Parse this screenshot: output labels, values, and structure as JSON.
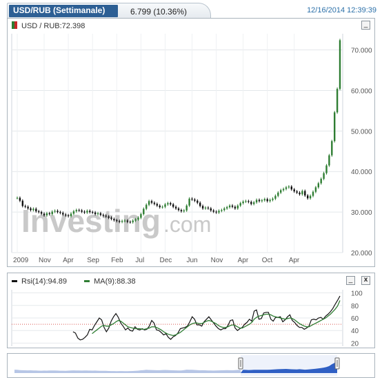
{
  "header": {
    "symbol": "USD/RUB (Settimanale)",
    "change": "6.799 (10.36%)",
    "timestamp": "12/16/2014 12:39:39"
  },
  "main_legend": {
    "label": "USD / RUB:72.398"
  },
  "rsi_legend": {
    "rsi_label": "Rsi(14):94.89",
    "ma_label": "MA(9):88.38"
  },
  "buttons": {
    "minimize": "_",
    "close": "x"
  },
  "watermark": {
    "brand": "Investing",
    "suffix": ".com"
  },
  "colors": {
    "up": "#2e7d32",
    "down": "#111111",
    "ma": "#2e7d32",
    "rsi": "#111111",
    "ref_line": "#d9534f",
    "nav_fill": "#2f5fc4"
  },
  "chart_data": [
    {
      "type": "line",
      "title": "USD / RUB",
      "ylim": [
        20,
        74
      ],
      "yticks": [
        "20.000",
        "30.000",
        "40.000",
        "50.000",
        "60.000",
        "70.000"
      ],
      "ytick_values": [
        20,
        30,
        40,
        50,
        60,
        70
      ],
      "xtick_labels": [
        "2009",
        "Nov",
        "Apr",
        "Sep",
        "Feb",
        "Jul",
        "Dec",
        "Jun",
        "Nov",
        "Apr",
        "Oct",
        "Apr"
      ],
      "xtick_index": [
        0,
        10,
        19,
        28,
        37,
        46,
        55,
        65,
        74,
        84,
        93,
        103
      ],
      "series": [
        {
          "name": "USD / RUB",
          "values": [
            33.5,
            32.8,
            31.5,
            31.3,
            30.9,
            30.5,
            30.8,
            30.2,
            30.0,
            29.6,
            29.2,
            29.7,
            29.5,
            30.1,
            30.3,
            30.0,
            29.8,
            29.4,
            29.2,
            29.0,
            29.6,
            30.2,
            30.5,
            30.4,
            30.1,
            29.9,
            30.3,
            30.0,
            29.9,
            29.5,
            29.7,
            29.3,
            29.1,
            28.9,
            28.6,
            28.3,
            28.0,
            27.8,
            27.6,
            27.8,
            27.9,
            27.6,
            27.5,
            27.9,
            28.2,
            28.6,
            29.5,
            30.8,
            31.8,
            32.7,
            32.3,
            32.0,
            31.6,
            31.2,
            31.3,
            31.9,
            32.2,
            31.9,
            31.3,
            30.9,
            30.5,
            30.2,
            30.4,
            31.6,
            33.3,
            33.1,
            32.8,
            32.3,
            31.5,
            30.9,
            31.1,
            30.9,
            30.4,
            30.1,
            29.9,
            30.3,
            30.5,
            30.9,
            31.2,
            31.6,
            31.3,
            30.9,
            31.6,
            32.2,
            32.6,
            32.7,
            32.5,
            32.0,
            32.4,
            33.0,
            32.7,
            32.9,
            33.2,
            32.7,
            33.0,
            33.3,
            34.0,
            34.8,
            35.4,
            35.7,
            36.1,
            36.3,
            35.6,
            35.1,
            34.8,
            34.4,
            35.2,
            34.1,
            33.4,
            34.0,
            35.0,
            36.1,
            37.1,
            38.2,
            39.6,
            41.5,
            44.0,
            47.5,
            54.6,
            60.4,
            72.4
          ]
        }
      ]
    },
    {
      "type": "line",
      "title": "Rsi(14)",
      "ylim": [
        15,
        105
      ],
      "yticks": [
        "20",
        "40",
        "60",
        "80",
        "100"
      ],
      "ytick_values": [
        20,
        40,
        60,
        80,
        100
      ],
      "reference_line": 50,
      "series": [
        {
          "name": "Rsi(14)",
          "values": [
            null,
            null,
            null,
            null,
            null,
            null,
            null,
            null,
            null,
            null,
            null,
            null,
            null,
            null,
            null,
            null,
            null,
            null,
            null,
            null,
            null,
            null,
            null,
            null,
            38,
            36,
            28,
            25,
            26,
            29,
            33,
            42,
            41,
            48,
            54,
            60,
            57,
            45,
            38,
            44,
            55,
            62,
            67,
            61,
            52,
            47,
            41,
            44,
            40,
            39,
            46,
            42,
            41,
            43,
            41,
            42,
            47,
            56,
            52,
            41,
            40,
            37,
            33,
            35,
            29,
            26,
            30,
            32,
            36,
            43,
            44,
            45,
            47,
            54,
            62,
            58,
            49,
            49,
            47,
            54,
            58,
            62,
            57,
            52,
            47,
            43,
            41,
            43,
            43,
            48,
            56,
            57,
            44,
            40,
            43,
            45,
            50,
            53,
            58,
            55,
            71,
            73,
            58,
            59,
            68,
            69,
            69,
            58,
            55,
            61,
            61,
            62,
            54,
            57,
            62,
            65,
            56,
            53,
            48,
            45,
            45,
            42,
            44,
            47,
            57,
            58,
            57,
            60,
            61,
            58,
            63,
            66,
            70,
            75,
            82,
            88,
            95
          ]
        },
        {
          "name": "MA(9)",
          "values": [
            null,
            null,
            null,
            null,
            null,
            null,
            null,
            null,
            null,
            null,
            null,
            null,
            null,
            null,
            null,
            null,
            null,
            null,
            null,
            null,
            null,
            null,
            null,
            null,
            null,
            null,
            null,
            null,
            null,
            null,
            null,
            null,
            35,
            38,
            41,
            44,
            47,
            48,
            47,
            47,
            49,
            51,
            54,
            56,
            55,
            52,
            49,
            46,
            45,
            44,
            43,
            43,
            43,
            42,
            42,
            43,
            44,
            46,
            46,
            45,
            43,
            41,
            38,
            36,
            34,
            33,
            32,
            33,
            35,
            37,
            40,
            43,
            46,
            49,
            51,
            52,
            52,
            51,
            51,
            53,
            55,
            56,
            55,
            53,
            51,
            48,
            46,
            45,
            45,
            46,
            48,
            49,
            48,
            46,
            44,
            44,
            46,
            48,
            50,
            53,
            58,
            61,
            63,
            64,
            65,
            66,
            66,
            65,
            63,
            62,
            61,
            60,
            59,
            58,
            59,
            60,
            59,
            57,
            54,
            51,
            49,
            47,
            46,
            46,
            48,
            50,
            52,
            54,
            56,
            58,
            60,
            63,
            66,
            70,
            74,
            79,
            88
          ]
        }
      ]
    }
  ]
}
